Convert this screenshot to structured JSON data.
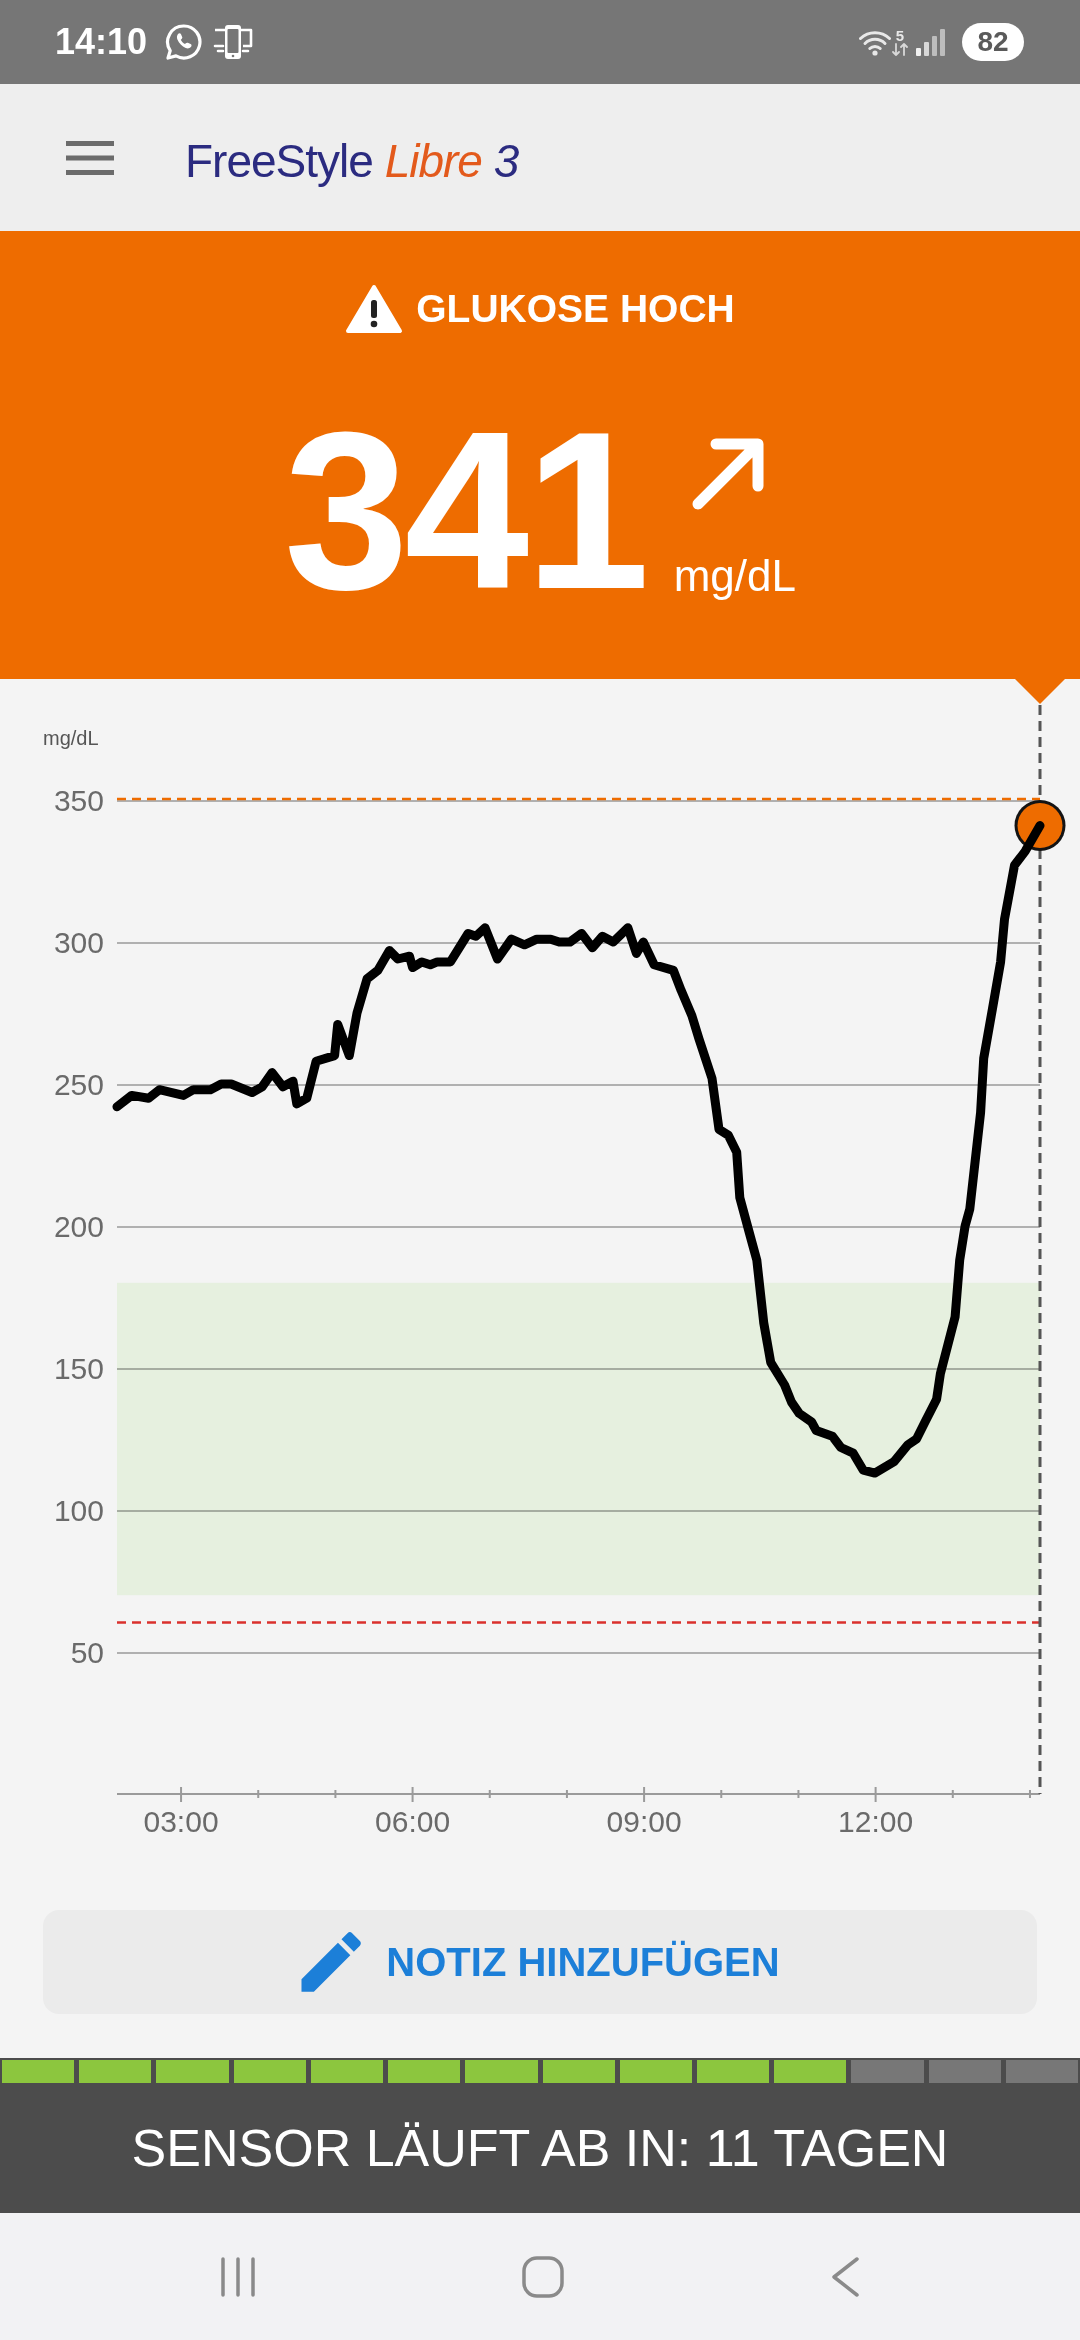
{
  "status_bar": {
    "time": "14:10",
    "wifi_band": "5",
    "battery": "82"
  },
  "header": {
    "logo": {
      "brand": "FreeStyle",
      "product": "Libre",
      "version": "3"
    }
  },
  "reading": {
    "high": true,
    "alert": "GLUKOSE HOCH",
    "value": "341",
    "unit": "mg/dL",
    "rising": true
  },
  "chart": {
    "chart_data": {
      "type": "line",
      "ylabel": "mg/dL",
      "x": [
        2.17,
        2.36,
        2.58,
        2.72,
        3.03,
        3.16,
        3.38,
        3.52,
        3.65,
        3.92,
        4.05,
        4.18,
        4.32,
        4.45,
        4.5,
        4.63,
        4.75,
        4.99,
        5.03,
        5.18,
        5.28,
        5.41,
        5.55,
        5.7,
        5.81,
        5.96,
        6.0,
        6.12,
        6.23,
        6.32,
        6.49,
        6.72,
        6.82,
        6.94,
        7.1,
        7.28,
        7.45,
        7.61,
        7.79,
        7.9,
        8.04,
        8.19,
        8.33,
        8.46,
        8.6,
        8.79,
        8.9,
        8.99,
        9.13,
        9.38,
        9.48,
        9.62,
        9.71,
        9.88,
        9.97,
        10.09,
        10.2,
        10.24,
        10.37,
        10.46,
        10.55,
        10.64,
        10.82,
        10.91,
        11.01,
        11.17,
        11.23,
        11.44,
        11.55,
        11.71,
        11.84,
        11.99,
        12.24,
        12.42,
        12.53,
        12.64,
        12.79,
        12.84,
        13.03,
        13.09,
        13.16,
        13.22,
        13.36,
        13.4,
        13.51,
        13.62,
        13.67,
        13.8,
        13.94,
        14.13
      ],
      "series": [
        {
          "color": "#000000",
          "values": [
            242,
            246,
            245,
            248,
            246,
            248,
            248,
            250,
            250,
            247,
            249,
            254,
            249,
            251,
            243,
            245,
            258,
            260,
            271,
            260,
            275,
            287,
            290,
            297,
            294,
            295,
            291,
            293,
            292,
            293,
            293,
            303,
            302,
            305,
            294,
            301,
            299,
            301,
            301,
            300,
            300,
            303,
            298,
            302,
            300,
            305,
            296,
            300,
            292,
            290,
            283,
            274,
            266,
            252,
            234,
            232,
            226,
            210,
            197,
            188,
            166,
            152,
            144,
            138,
            134,
            131,
            128,
            126,
            122,
            120,
            114,
            113,
            117,
            123,
            125,
            131,
            139,
            148,
            168,
            188,
            200,
            206,
            240,
            259,
            276,
            293,
            308,
            327,
            332,
            341
          ]
        }
      ],
      "xlim": [
        2.17,
        14.13
      ],
      "ylim": [
        0,
        350
      ],
      "xticks": [
        {
          "value": 3,
          "label": "03:00"
        },
        {
          "value": 6,
          "label": "06:00"
        },
        {
          "value": 9,
          "label": "09:00"
        },
        {
          "value": 12,
          "label": "12:00"
        }
      ],
      "yticks": [
        50,
        100,
        150,
        200,
        250,
        300,
        350
      ],
      "grid": true,
      "bands": [
        {
          "axis": "y",
          "from": 70,
          "to": 180,
          "color": "#e6f0df"
        }
      ],
      "ref_lines": [
        {
          "axis": "y",
          "value": 350,
          "color": "#ee6c00"
        },
        {
          "axis": "y",
          "value": 60,
          "color": "#d9302c"
        }
      ]
    }
  },
  "note_button": {
    "label": "NOTIZ HINZUFÜGEN"
  },
  "sensor": {
    "segments": [
      {
        "filled": true
      },
      {
        "filled": true
      },
      {
        "filled": true
      },
      {
        "filled": true
      },
      {
        "filled": true
      },
      {
        "filled": true
      },
      {
        "filled": true
      },
      {
        "filled": true
      },
      {
        "filled": true
      },
      {
        "filled": true
      },
      {
        "filled": true
      },
      {
        "filled": false
      },
      {
        "filled": false
      },
      {
        "filled": false
      }
    ],
    "message": "SENSOR LÄUFT AB IN: 11 TAGEN"
  }
}
